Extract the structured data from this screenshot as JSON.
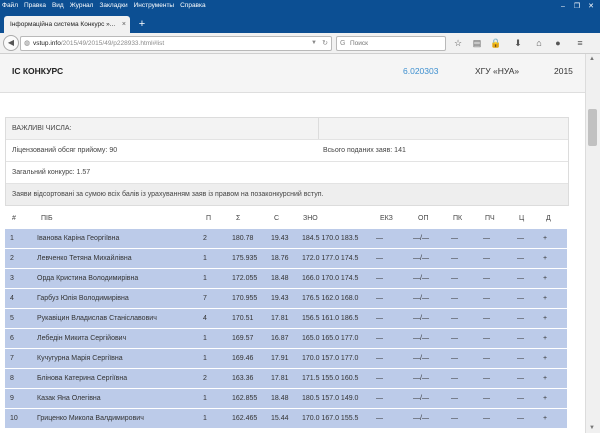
{
  "menu": [
    "Файл",
    "Правка",
    "Вид",
    "Журнал",
    "Закладки",
    "Инструменты",
    "Справка"
  ],
  "window_controls": [
    "–",
    "❐",
    "✕"
  ],
  "tab": {
    "title": "Інформаційна система Конкурс »...",
    "close": "×",
    "new": "+"
  },
  "nav": {
    "url_host": "vstup.info",
    "url_path": "/2015/49/2015/49/p228933.html#list",
    "search_placeholder": "Поиск",
    "search_engine_icon": "google-icon"
  },
  "app": {
    "name": "ІС КОНКУРС",
    "code": "6.020303",
    "university": "ХГУ «НУА»",
    "year": "2015"
  },
  "info": {
    "header": "ВАЖЛИВІ ЧИСЛА:",
    "licensed": "Ліцензований обсяг прийому: 90",
    "total": "Всього поданих заяв: 141",
    "competition": "Загальний конкурс: 1.57",
    "note": "Заяви відсортовані за сумою всіх балів із урахуванням заяв із правом на позаконкурсний вступ."
  },
  "table": {
    "columns": [
      "#",
      "ПІБ",
      "П",
      "Σ",
      "С",
      "ЗНО",
      "ЕКЗ",
      "ОП",
      "ПК",
      "ПЧ",
      "Ц",
      "Д"
    ],
    "row_color": "#bccbe9",
    "rows": [
      {
        "n": "1",
        "name": "Іванова Каріна Георгіївна",
        "p": "2",
        "sum": "180.78",
        "c": "19.43",
        "zno": "184.5 170.0 183.5",
        "ekz": "—",
        "op": "—/—",
        "pk": "—",
        "pch": "—",
        "ts": "—",
        "d": "+"
      },
      {
        "n": "2",
        "name": "Левченко Тетяна Михайлівна",
        "p": "1",
        "sum": "175.935",
        "c": "18.76",
        "zno": "172.0 177.0 174.5",
        "ekz": "—",
        "op": "—/—",
        "pk": "—",
        "pch": "—",
        "ts": "—",
        "d": "+"
      },
      {
        "n": "3",
        "name": "Орда Кристина Володимирівна",
        "p": "1",
        "sum": "172.055",
        "c": "18.48",
        "zno": "166.0 170.0 174.5",
        "ekz": "—",
        "op": "—/—",
        "pk": "—",
        "pch": "—",
        "ts": "—",
        "d": "+"
      },
      {
        "n": "4",
        "name": "Гарбуз Юлія Володимирівна",
        "p": "7",
        "sum": "170.955",
        "c": "19.43",
        "zno": "176.5 162.0 168.0",
        "ekz": "—",
        "op": "—/—",
        "pk": "—",
        "pch": "—",
        "ts": "—",
        "d": "+"
      },
      {
        "n": "5",
        "name": "Рукавіцин Владислав Станіславович",
        "p": "4",
        "sum": "170.51",
        "c": "17.81",
        "zno": "156.5 161.0 186.5",
        "ekz": "—",
        "op": "—/—",
        "pk": "—",
        "pch": "—",
        "ts": "—",
        "d": "+"
      },
      {
        "n": "6",
        "name": "Лебедін Микита Сергійович",
        "p": "1",
        "sum": "169.57",
        "c": "16.87",
        "zno": "165.0 165.0 177.0",
        "ekz": "—",
        "op": "—/—",
        "pk": "—",
        "pch": "—",
        "ts": "—",
        "d": "+"
      },
      {
        "n": "7",
        "name": "Кучугурна Марія Сергіївна",
        "p": "1",
        "sum": "169.46",
        "c": "17.91",
        "zno": "170.0 157.0 177.0",
        "ekz": "—",
        "op": "—/—",
        "pk": "—",
        "pch": "—",
        "ts": "—",
        "d": "+"
      },
      {
        "n": "8",
        "name": "Блінова Катерина Сергіївна",
        "p": "2",
        "sum": "163.36",
        "c": "17.81",
        "zno": "171.5 155.0 160.5",
        "ekz": "—",
        "op": "—/—",
        "pk": "—",
        "pch": "—",
        "ts": "—",
        "d": "+"
      },
      {
        "n": "9",
        "name": "Казак Яна Олегівна",
        "p": "1",
        "sum": "162.855",
        "c": "18.48",
        "zno": "180.5 157.0 149.0",
        "ekz": "—",
        "op": "—/—",
        "pk": "—",
        "pch": "—",
        "ts": "—",
        "d": "+"
      },
      {
        "n": "10",
        "name": "Гриценко Микола Валдимирович",
        "p": "1",
        "sum": "162.465",
        "c": "15.44",
        "zno": "170.0 167.0 155.5",
        "ekz": "—",
        "op": "—/—",
        "pk": "—",
        "pch": "—",
        "ts": "—",
        "d": "+"
      }
    ]
  }
}
